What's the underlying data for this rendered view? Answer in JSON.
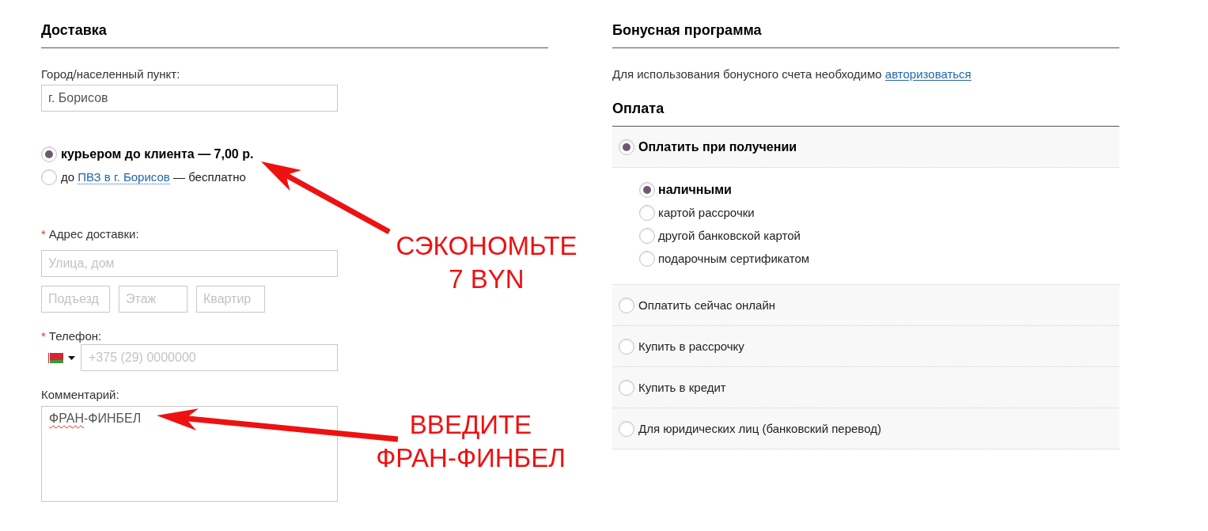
{
  "delivery": {
    "title": "Доставка",
    "city": {
      "label": "Город/населенный пункт:",
      "value": "г. Борисов"
    },
    "methods": [
      {
        "selected": true,
        "text": "курьером до клиента — 7,00 р."
      },
      {
        "selected": false,
        "text": "до",
        "link": "ПВЗ в г. Борисов",
        "text_after": "— бесплатно"
      }
    ],
    "address": {
      "required_mark": "*",
      "label": "Адрес доставки:",
      "street": {
        "placeholder": "Улица, дом"
      },
      "details": [
        {
          "placeholder": "Подъезд"
        },
        {
          "placeholder": "Этаж"
        },
        {
          "placeholder": "Квартир"
        }
      ]
    },
    "phone": {
      "required_mark": "*",
      "label": "Телефон:",
      "placeholder": "+375 (29) 0000000"
    },
    "comment": {
      "label": "Комментарий:",
      "value": [
        {
          "text": "ФРАН",
          "misspelled": true
        },
        {
          "text": "-ФИНБЕЛ",
          "misspelled": false
        }
      ]
    }
  },
  "bonus": {
    "title": "Бонусная программа",
    "text": "Для использования бонусного счета необходимо",
    "link": "авторизоваться"
  },
  "payment": {
    "title": "Оплата",
    "options": [
      {
        "label": "Оплатить при получении",
        "selected": true,
        "sub_options": [
          {
            "label": "наличными",
            "selected": true
          },
          {
            "label": "картой рассрочки",
            "selected": false
          },
          {
            "label": "другой банковской картой",
            "selected": false
          },
          {
            "label": "подарочным сертификатом",
            "selected": false
          }
        ]
      },
      {
        "label": "Оплатить сейчас онлайн",
        "selected": false
      },
      {
        "label": "Купить в рассрочку",
        "selected": false
      },
      {
        "label": "Купить в кредит",
        "selected": false
      },
      {
        "label": "Для юридических лиц (банковский перевод)",
        "selected": false
      }
    ]
  },
  "annotations": [
    {
      "lines": [
        "СЭКОНОМЬТЕ",
        "7 BYN"
      ]
    },
    {
      "lines": [
        "ВВЕДИТЕ",
        "ФРАН-ФИНБЕЛ"
      ]
    }
  ]
}
